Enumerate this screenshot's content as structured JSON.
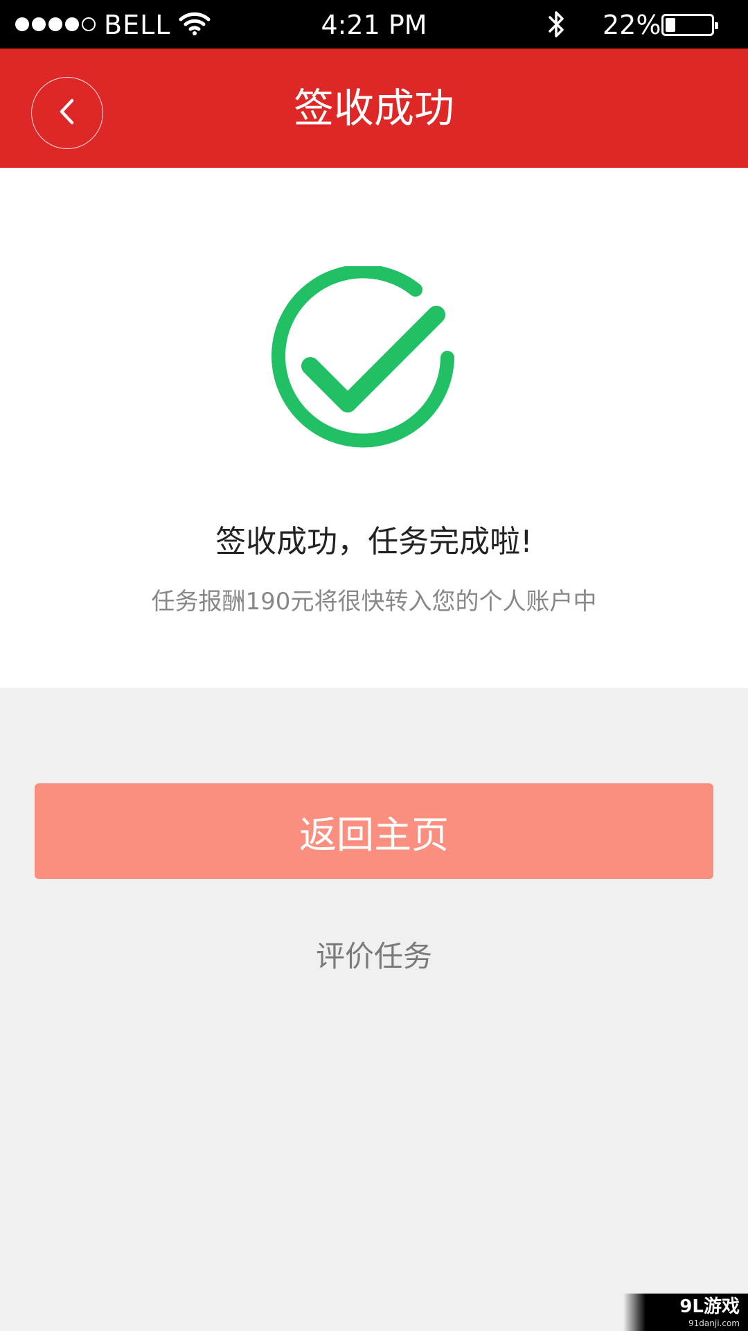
{
  "status_bar": {
    "carrier": "BELL",
    "time": "4:21 PM",
    "battery_percent": "22%",
    "battery_level": 0.22,
    "signal_bars_filled": 4,
    "signal_bars_total": 5
  },
  "nav": {
    "title": "签收成功",
    "back_icon": "chevron-left-icon"
  },
  "success": {
    "icon": "check-circle-icon",
    "icon_color": "#22c064",
    "headline": "签收成功，任务完成啦!",
    "subtext": "任务报酬190元将很快转入您的个人账户中"
  },
  "actions": {
    "home_label": "返回主页",
    "rate_label": "评价任务"
  },
  "watermark": {
    "main": "9L游戏",
    "sub": "91danji.com"
  },
  "colors": {
    "nav_red": "#de2828",
    "button_salmon": "#fa8f7f",
    "page_bg": "#f0f0f0"
  }
}
